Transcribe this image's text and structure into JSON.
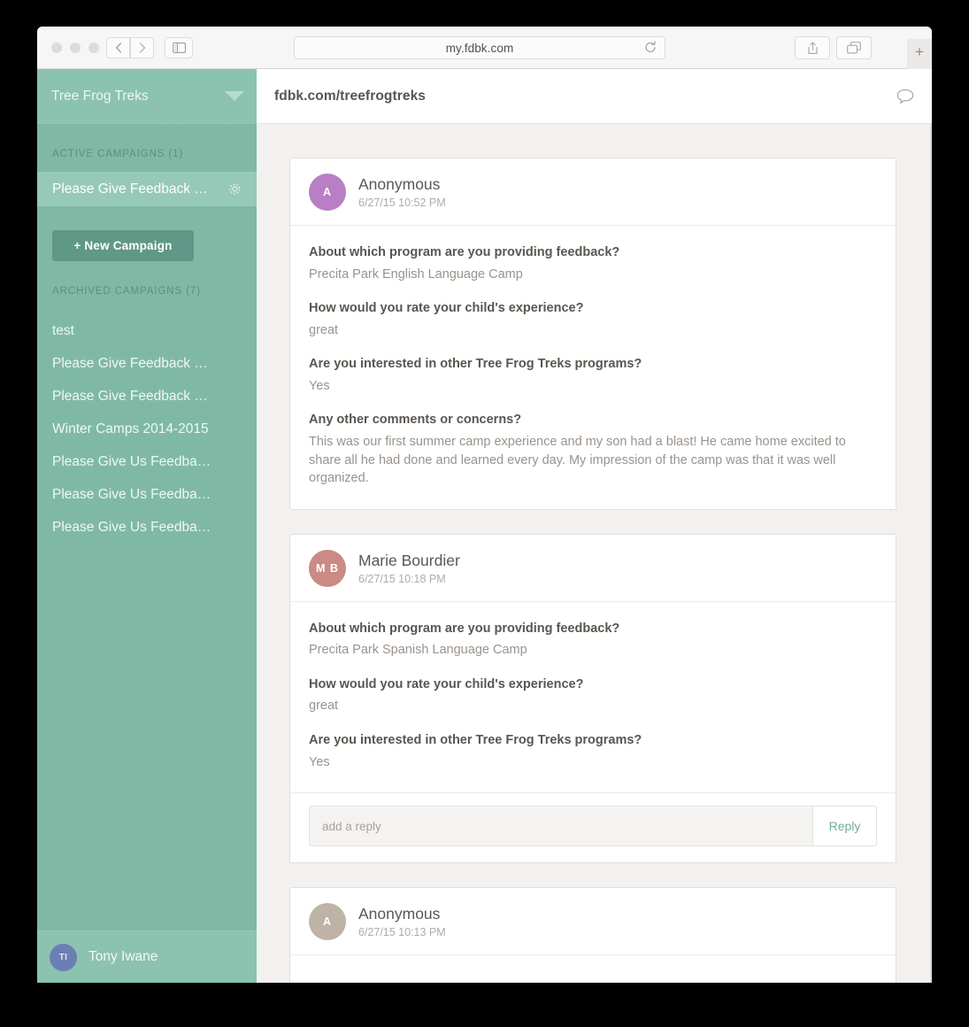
{
  "browser": {
    "url": "my.fdbk.com",
    "back_icon": "chevron-left-icon",
    "forward_icon": "chevron-right-icon",
    "sidebar_icon": "sidebar-toggle-icon",
    "reload_icon": "reload-icon",
    "share_icon": "share-icon",
    "tabs_icon": "show-tabs-icon",
    "newtab_label": "+"
  },
  "sidebar": {
    "org_name": "Tree Frog Treks",
    "org_caret_icon": "chevron-down-icon",
    "active_label": "ACTIVE CAMPAIGNS (1)",
    "active_campaigns": [
      {
        "label": "Please Give Feedback …",
        "gear_icon": "gear-icon"
      }
    ],
    "new_campaign_label": "+ New Campaign",
    "archived_label": "ARCHIVED CAMPAIGNS (7)",
    "archived_campaigns": [
      {
        "label": "test"
      },
      {
        "label": "Please Give Feedback …"
      },
      {
        "label": "Please Give Feedback …"
      },
      {
        "label": "Winter Camps 2014-2015"
      },
      {
        "label": "Please Give Us Feedba…"
      },
      {
        "label": "Please Give Us Feedba…"
      },
      {
        "label": "Please Give Us Feedba…"
      }
    ],
    "user": {
      "initials": "TI",
      "name": "Tony Iwane",
      "avatar_color": "#6b7fb4"
    }
  },
  "main": {
    "page_url": "fdbk.com/treefrogtreks",
    "comment_icon": "speech-bubble-icon",
    "feedback": [
      {
        "author": "Anonymous",
        "initials": "A",
        "avatar_color": "#b87fc4",
        "timestamp": "6/27/15 10:52 PM",
        "qa": [
          {
            "q": "About which program are you providing feedback?",
            "a": "Precita Park English Language Camp"
          },
          {
            "q": "How would you rate your child's experience?",
            "a": "great"
          },
          {
            "q": "Are you interested in other Tree Frog Treks programs?",
            "a": "Yes"
          },
          {
            "q": "Any other comments or concerns?",
            "a": "This was our first summer camp experience and my son had a blast! He came home excited to share all he had done and learned every day. My impression of the camp was that it was well organized."
          }
        ],
        "has_reply_box": false
      },
      {
        "author": "Marie Bourdier",
        "initials": "M B",
        "avatar_color": "#c98b83",
        "timestamp": "6/27/15 10:18 PM",
        "qa": [
          {
            "q": "About which program are you providing feedback?",
            "a": "Precita Park Spanish Language Camp"
          },
          {
            "q": "How would you rate your child's experience?",
            "a": "great"
          },
          {
            "q": "Are you interested in other Tree Frog Treks programs?",
            "a": "Yes"
          }
        ],
        "has_reply_box": true,
        "reply_placeholder": "add a reply",
        "reply_button": "Reply"
      },
      {
        "author": "Anonymous",
        "initials": "A",
        "avatar_color": "#bfb2a6",
        "timestamp": "6/27/15 10:13 PM",
        "qa": [],
        "has_reply_box": false
      }
    ]
  },
  "colors": {
    "sidebar_bg": "#7fb9a6",
    "sidebar_header_bg": "#8cc2b0",
    "sidebar_active_bg": "#96c9b8",
    "new_campaign_bg": "#5f9886",
    "page_bg": "#f2f1ef",
    "reply_accent": "#6fae9a"
  }
}
